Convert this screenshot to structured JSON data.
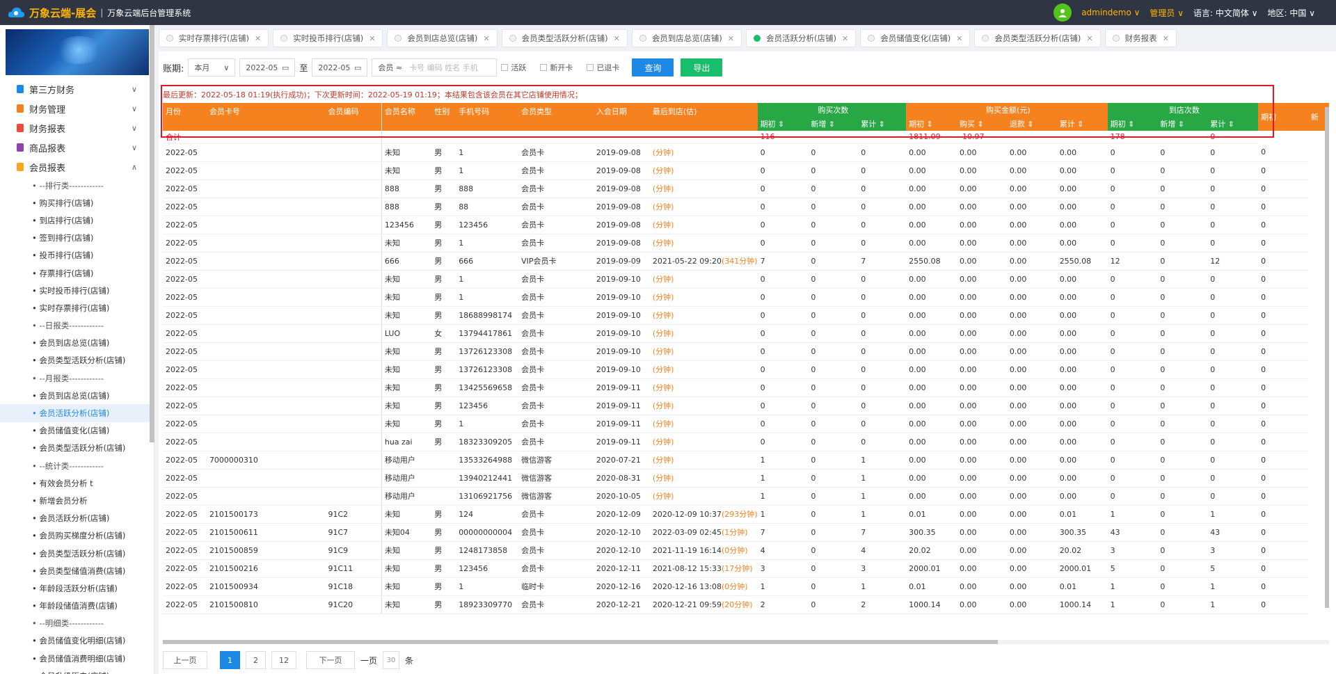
{
  "header": {
    "brand": "万象云端-展会",
    "sep": "|",
    "subtitle": "万象云端后台管理系统",
    "username": "admindemo ∨",
    "role": "管理员 ∨",
    "lang_label": "语言:",
    "lang_value": "中文简体 ∨",
    "region_label": "地区:",
    "region_value": "中国 ∨"
  },
  "sidebar": {
    "menus": [
      {
        "label": "第三方财务",
        "color": "#1e88e5",
        "chev": "∨"
      },
      {
        "label": "财务管理",
        "color": "#f5821f",
        "chev": "∨"
      },
      {
        "label": "财务报表",
        "color": "#e74c3c",
        "chev": "∨"
      },
      {
        "label": "商品报表",
        "color": "#8e44ad",
        "chev": "∨"
      },
      {
        "label": "会员报表",
        "color": "#f5a623",
        "chev": "∧"
      }
    ],
    "subs": [
      "• --排行类------------",
      "• 购买排行(店铺)",
      "• 到店排行(店铺)",
      "• 签到排行(店铺)",
      "• 投币排行(店铺)",
      "• 存票排行(店铺)",
      "• 实时投币排行(店铺)",
      "• 实时存票排行(店铺)",
      "• --日报类------------",
      "• 会员到店总览(店铺)",
      "• 会员类型活跃分析(店铺)",
      "• --月报类------------",
      "• 会员到店总览(店铺)",
      "• 会员活跃分析(店铺)",
      "• 会员储值变化(店铺)",
      "• 会员类型活跃分析(店铺)",
      "• --统计类------------",
      "• 有效会员分析 t",
      "• 新增会员分析",
      "• 会员活跃分析(店铺)",
      "• 会员购买梯度分析(店铺)",
      "• 会员类型活跃分析(店铺)",
      "• 会员类型储值消费(店铺)",
      "• 年龄段活跃分析(店铺)",
      "• 年龄段储值消费(店铺)",
      "• --明细类------------",
      "• 会员储值变化明细(店铺)",
      "• 会员储值消费明细(店铺)",
      "• 会员升级历史(店铺)"
    ]
  },
  "tabs": [
    "实时存票排行(店铺)",
    "实时投币排行(店铺)",
    "会员到店总览(店铺)",
    "会员类型活跃分析(店铺)",
    "会员到店总览(店铺)",
    "会员活跃分析(店铺)",
    "会员储值变化(店铺)",
    "会员类型活跃分析(店铺)",
    "财务报表"
  ],
  "filter": {
    "period_label": "账期:",
    "period_value": "本月",
    "date_from": "2022-05",
    "to": "至",
    "date_to": "2022-05",
    "member_label": "会员 ≈",
    "member_placeholder": "卡号 编码 姓名 手机",
    "cb_active": "活跃",
    "cb_new": "新开卡",
    "cb_refund": "已退卡",
    "query": "查询",
    "export": "导出"
  },
  "info": "最后更新：2022-05-18 01:19(执行成功)；下次更新时间：2022-05-19 01:19；本结果包含该会员在其它店铺使用情况；",
  "table": {
    "head1": [
      "月份",
      "会员卡号",
      "会员编码",
      "会员名称",
      "性别",
      "手机号码",
      "会员类型",
      "入会日期",
      "最后到店(估)"
    ],
    "groups": [
      "购买次数",
      "购买金额(元)",
      "到店次数",
      "期初",
      "新"
    ],
    "sub": [
      "期初 ⇕",
      "新增 ⇕",
      "累计 ⇕",
      "期初 ⇕",
      "购买 ⇕",
      "退款 ⇕",
      "累计 ⇕",
      "期初 ⇕",
      "新增 ⇕",
      "累计 ⇕"
    ],
    "sum": [
      "合计",
      "",
      "",
      "",
      "",
      "",
      "",
      "",
      "",
      "",
      "116",
      "",
      "",
      "1811.09",
      "-10.97",
      "",
      "",
      "178",
      "",
      "0"
    ],
    "rows": [
      [
        "2022-05",
        "",
        "",
        "未知",
        "男",
        "1",
        "会员卡",
        "2019-09-08",
        "",
        "(分钟)",
        "0",
        "0",
        "0",
        "0.00",
        "0.00",
        "0.00",
        "0.00",
        "0",
        "0",
        "0",
        "0"
      ],
      [
        "2022-05",
        "",
        "",
        "未知",
        "男",
        "1",
        "会员卡",
        "2019-09-08",
        "",
        "(分钟)",
        "0",
        "0",
        "0",
        "0.00",
        "0.00",
        "0.00",
        "0.00",
        "0",
        "0",
        "0",
        "0"
      ],
      [
        "2022-05",
        "",
        "",
        "888",
        "男",
        "888",
        "会员卡",
        "2019-09-08",
        "",
        "(分钟)",
        "0",
        "0",
        "0",
        "0.00",
        "0.00",
        "0.00",
        "0.00",
        "0",
        "0",
        "0",
        "0"
      ],
      [
        "2022-05",
        "",
        "",
        "888",
        "男",
        "88",
        "会员卡",
        "2019-09-08",
        "",
        "(分钟)",
        "0",
        "0",
        "0",
        "0.00",
        "0.00",
        "0.00",
        "0.00",
        "0",
        "0",
        "0",
        "0"
      ],
      [
        "2022-05",
        "",
        "",
        "123456",
        "男",
        "123456",
        "会员卡",
        "2019-09-08",
        "",
        "(分钟)",
        "0",
        "0",
        "0",
        "0.00",
        "0.00",
        "0.00",
        "0.00",
        "0",
        "0",
        "0",
        "0"
      ],
      [
        "2022-05",
        "",
        "",
        "未知",
        "男",
        "1",
        "会员卡",
        "2019-09-08",
        "",
        "(分钟)",
        "0",
        "0",
        "0",
        "0.00",
        "0.00",
        "0.00",
        "0.00",
        "0",
        "0",
        "0",
        "0"
      ],
      [
        "2022-05",
        "",
        "",
        "666",
        "男",
        "666",
        "VIP会员卡",
        "2019-09-09",
        "2021-05-22 09:20",
        "(341分钟)",
        "7",
        "0",
        "7",
        "2550.08",
        "0.00",
        "0.00",
        "2550.08",
        "12",
        "0",
        "12",
        "0"
      ],
      [
        "2022-05",
        "",
        "",
        "未知",
        "男",
        "1",
        "会员卡",
        "2019-09-10",
        "",
        "(分钟)",
        "0",
        "0",
        "0",
        "0.00",
        "0.00",
        "0.00",
        "0.00",
        "0",
        "0",
        "0",
        "0"
      ],
      [
        "2022-05",
        "",
        "",
        "未知",
        "男",
        "1",
        "会员卡",
        "2019-09-10",
        "",
        "(分钟)",
        "0",
        "0",
        "0",
        "0.00",
        "0.00",
        "0.00",
        "0.00",
        "0",
        "0",
        "0",
        "0"
      ],
      [
        "2022-05",
        "",
        "",
        "未知",
        "男",
        "18688998174",
        "会员卡",
        "2019-09-10",
        "",
        "(分钟)",
        "0",
        "0",
        "0",
        "0.00",
        "0.00",
        "0.00",
        "0.00",
        "0",
        "0",
        "0",
        "0"
      ],
      [
        "2022-05",
        "",
        "",
        "LUO",
        "女",
        "13794417861",
        "会员卡",
        "2019-09-10",
        "",
        "(分钟)",
        "0",
        "0",
        "0",
        "0.00",
        "0.00",
        "0.00",
        "0.00",
        "0",
        "0",
        "0",
        "0"
      ],
      [
        "2022-05",
        "",
        "",
        "未知",
        "男",
        "13726123308",
        "会员卡",
        "2019-09-10",
        "",
        "(分钟)",
        "0",
        "0",
        "0",
        "0.00",
        "0.00",
        "0.00",
        "0.00",
        "0",
        "0",
        "0",
        "0"
      ],
      [
        "2022-05",
        "",
        "",
        "未知",
        "男",
        "13726123308",
        "会员卡",
        "2019-09-10",
        "",
        "(分钟)",
        "0",
        "0",
        "0",
        "0.00",
        "0.00",
        "0.00",
        "0.00",
        "0",
        "0",
        "0",
        "0"
      ],
      [
        "2022-05",
        "",
        "",
        "未知",
        "男",
        "13425569658",
        "会员卡",
        "2019-09-11",
        "",
        "(分钟)",
        "0",
        "0",
        "0",
        "0.00",
        "0.00",
        "0.00",
        "0.00",
        "0",
        "0",
        "0",
        "0"
      ],
      [
        "2022-05",
        "",
        "",
        "未知",
        "男",
        "123456",
        "会员卡",
        "2019-09-11",
        "",
        "(分钟)",
        "0",
        "0",
        "0",
        "0.00",
        "0.00",
        "0.00",
        "0.00",
        "0",
        "0",
        "0",
        "0"
      ],
      [
        "2022-05",
        "",
        "",
        "未知",
        "男",
        "1",
        "会员卡",
        "2019-09-11",
        "",
        "(分钟)",
        "0",
        "0",
        "0",
        "0.00",
        "0.00",
        "0.00",
        "0.00",
        "0",
        "0",
        "0",
        "0"
      ],
      [
        "2022-05",
        "",
        "",
        "hua zai",
        "男",
        "18323309205",
        "会员卡",
        "2019-09-11",
        "",
        "(分钟)",
        "0",
        "0",
        "0",
        "0.00",
        "0.00",
        "0.00",
        "0.00",
        "0",
        "0",
        "0",
        "0"
      ],
      [
        "2022-05",
        "7000000310",
        "",
        "移动用户",
        "",
        "13533264988",
        "微信游客",
        "2020-07-21",
        "",
        "(分钟)",
        "1",
        "0",
        "1",
        "0.00",
        "0.00",
        "0.00",
        "0.00",
        "0",
        "0",
        "0",
        "0"
      ],
      [
        "2022-05",
        "",
        "",
        "移动用户",
        "",
        "13940212441",
        "微信游客",
        "2020-08-31",
        "",
        "(分钟)",
        "1",
        "0",
        "1",
        "0.00",
        "0.00",
        "0.00",
        "0.00",
        "0",
        "0",
        "0",
        "0"
      ],
      [
        "2022-05",
        "",
        "",
        "移动用户",
        "",
        "13106921756",
        "微信游客",
        "2020-10-05",
        "",
        "(分钟)",
        "1",
        "0",
        "1",
        "0.00",
        "0.00",
        "0.00",
        "0.00",
        "0",
        "0",
        "0",
        "0"
      ],
      [
        "2022-05",
        "2101500173",
        "91C2",
        "未知",
        "男",
        "124",
        "会员卡",
        "2020-12-09",
        "2020-12-09 10:37",
        "(293分钟)",
        "1",
        "0",
        "1",
        "0.01",
        "0.00",
        "0.00",
        "0.01",
        "1",
        "0",
        "1",
        "0"
      ],
      [
        "2022-05",
        "2101500611",
        "91C7",
        "未知04",
        "男",
        "00000000004",
        "会员卡",
        "2020-12-10",
        "2022-03-09 02:45",
        "(1分钟)",
        "7",
        "0",
        "7",
        "300.35",
        "0.00",
        "0.00",
        "300.35",
        "43",
        "0",
        "43",
        "0"
      ],
      [
        "2022-05",
        "2101500859",
        "91C9",
        "未知",
        "男",
        "1248173858",
        "会员卡",
        "2020-12-10",
        "2021-11-19 16:14",
        "(0分钟)",
        "4",
        "0",
        "4",
        "20.02",
        "0.00",
        "0.00",
        "20.02",
        "3",
        "0",
        "3",
        "0"
      ],
      [
        "2022-05",
        "2101500216",
        "91C11",
        "未知",
        "男",
        "123456",
        "会员卡",
        "2020-12-11",
        "2021-08-12 15:33",
        "(17分钟)",
        "3",
        "0",
        "3",
        "2000.01",
        "0.00",
        "0.00",
        "2000.01",
        "5",
        "0",
        "5",
        "0"
      ],
      [
        "2022-05",
        "2101500934",
        "91C18",
        "未知",
        "男",
        "1",
        "临时卡",
        "2020-12-16",
        "2020-12-16 13:08",
        "(0分钟)",
        "1",
        "0",
        "1",
        "0.01",
        "0.00",
        "0.00",
        "0.01",
        "1",
        "0",
        "1",
        "0"
      ],
      [
        "2022-05",
        "2101500810",
        "91C20",
        "未知",
        "男",
        "18923309770",
        "会员卡",
        "2020-12-21",
        "2020-12-21 09:59",
        "(20分钟)",
        "2",
        "0",
        "2",
        "1000.14",
        "0.00",
        "0.00",
        "1000.14",
        "1",
        "0",
        "1",
        "0"
      ]
    ]
  },
  "pager": {
    "prev": "上一页",
    "p1": "1",
    "p2": "2",
    "p3": "12",
    "next": "下一页",
    "per_label": "一页",
    "per_value": "30",
    "unit": "条"
  }
}
